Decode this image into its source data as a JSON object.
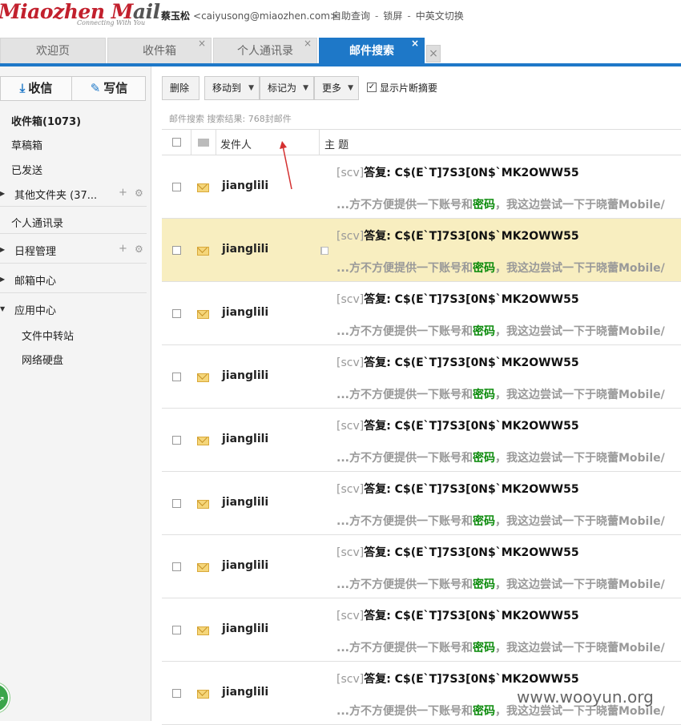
{
  "header": {
    "logo_main_a": "Miaozhen M",
    "logo_main_b": "ail",
    "logo_sub": "Connecting With You",
    "user_name": "蔡玉松",
    "user_email": "<caiyusong@miaozhen.com>",
    "links": [
      "自助查询",
      "锁屏",
      "中英文切换"
    ],
    "link_sep": "-"
  },
  "tabs": [
    {
      "label": "欢迎页"
    },
    {
      "label": "收件箱"
    },
    {
      "label": "个人通讯录"
    },
    {
      "label": "邮件搜索"
    }
  ],
  "tab_close_glyph": "×",
  "sidebar": {
    "receive": "收信",
    "write": "写信",
    "items": [
      {
        "label": "收件箱(1073)"
      },
      {
        "label": "草稿箱"
      },
      {
        "label": "已发送"
      },
      {
        "label": "其他文件夹 (37..."
      },
      {
        "label": "个人通讯录"
      },
      {
        "label": "日程管理"
      },
      {
        "label": "邮箱中心"
      },
      {
        "label": "应用中心"
      },
      {
        "label": "文件中转站"
      },
      {
        "label": "网络硬盘"
      }
    ]
  },
  "toolbar": {
    "delete": "删除",
    "move_to": "移动到",
    "mark_as": "标记为",
    "more": "更多",
    "show_snippet": "显示片断摘要",
    "show_snippet_checked": true
  },
  "search_info": "邮件搜索 搜索结果: 768封邮件",
  "table": {
    "col_sender": "发件人",
    "col_subject": "主 题"
  },
  "emails": [
    {
      "sender": "jianglili",
      "tag": "[scv]",
      "subject": "答复: C$(E`T]7S3[0N$`MK2OWW55",
      "snippet_a": "...方不方便提供一下账号和",
      "snippet_kw": "密码",
      "snippet_b": "，我这边尝试一下于晓蕾Mobile/"
    },
    {
      "sender": "jianglili",
      "tag": "[scv]",
      "subject": "答复: C$(E`T]7S3[0N$`MK2OWW55",
      "snippet_a": "...方不方便提供一下账号和",
      "snippet_kw": "密码",
      "snippet_b": "，我这边尝试一下于晓蕾Mobile/"
    },
    {
      "sender": "jianglili",
      "tag": "[scv]",
      "subject": "答复: C$(E`T]7S3[0N$`MK2OWW55",
      "snippet_a": "...方不方便提供一下账号和",
      "snippet_kw": "密码",
      "snippet_b": "，我这边尝试一下于晓蕾Mobile/"
    },
    {
      "sender": "jianglili",
      "tag": "[scv]",
      "subject": "答复: C$(E`T]7S3[0N$`MK2OWW55",
      "snippet_a": "...方不方便提供一下账号和",
      "snippet_kw": "密码",
      "snippet_b": "，我这边尝试一下于晓蕾Mobile/"
    },
    {
      "sender": "jianglili",
      "tag": "[scv]",
      "subject": "答复: C$(E`T]7S3[0N$`MK2OWW55",
      "snippet_a": "...方不方便提供一下账号和",
      "snippet_kw": "密码",
      "snippet_b": "，我这边尝试一下于晓蕾Mobile/"
    },
    {
      "sender": "jianglili",
      "tag": "[scv]",
      "subject": "答复: C$(E`T]7S3[0N$`MK2OWW55",
      "snippet_a": "...方不方便提供一下账号和",
      "snippet_kw": "密码",
      "snippet_b": "，我这边尝试一下于晓蕾Mobile/"
    },
    {
      "sender": "jianglili",
      "tag": "[scv]",
      "subject": "答复: C$(E`T]7S3[0N$`MK2OWW55",
      "snippet_a": "...方不方便提供一下账号和",
      "snippet_kw": "密码",
      "snippet_b": "，我这边尝试一下于晓蕾Mobile/"
    },
    {
      "sender": "jianglili",
      "tag": "[scv]",
      "subject": "答复: C$(E`T]7S3[0N$`MK2OWW55",
      "snippet_a": "...方不方便提供一下账号和",
      "snippet_kw": "密码",
      "snippet_b": "，我这边尝试一下于晓蕾Mobile/"
    },
    {
      "sender": "jianglili",
      "tag": "[scv]",
      "subject": "答复: C$(E`T]7S3[0N$`MK2OWW55",
      "snippet_a": "...方不方便提供一下账号和",
      "snippet_kw": "密码",
      "snippet_b": "，我这边尝试一下于晓蕾Mobile/"
    }
  ],
  "highlighted_row": 1,
  "watermark": "www.wooyun.org",
  "colors": {
    "accent": "#1e78c8",
    "highlight": "#f8eec0",
    "keyword": "#0a8a0a",
    "logo": "#c2202d"
  }
}
